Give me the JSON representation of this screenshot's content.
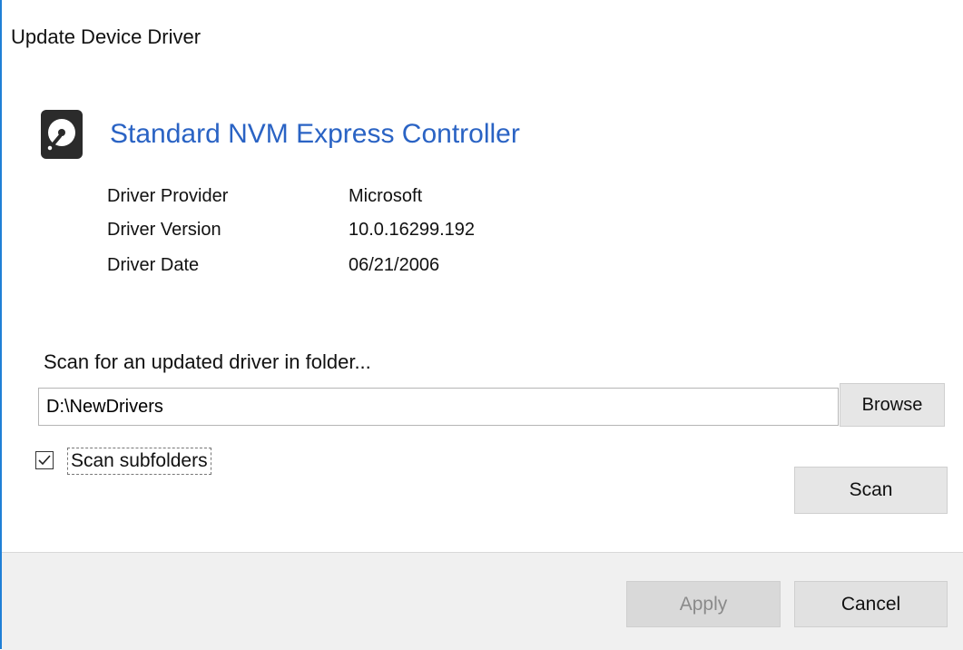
{
  "window": {
    "title": "Update Device Driver",
    "accent_color": "#1f7fd6"
  },
  "device": {
    "icon": "hard-drive-icon",
    "name": "Standard NVM Express Controller",
    "name_color": "#2a63c4"
  },
  "driver_info": [
    {
      "label": "Driver Provider",
      "value": "Microsoft"
    },
    {
      "label": "Driver Version",
      "value": "10.0.16299.192"
    },
    {
      "label": "Driver Date",
      "value": "06/21/2006"
    }
  ],
  "scan": {
    "label": "Scan for an updated driver in folder...",
    "folder_value": "D:\\NewDrivers",
    "browse_label": "Browse",
    "subfolders_label": "Scan subfolders",
    "subfolders_checked": true,
    "scan_label": "Scan"
  },
  "footer": {
    "apply_label": "Apply",
    "apply_enabled": false,
    "cancel_label": "Cancel"
  }
}
